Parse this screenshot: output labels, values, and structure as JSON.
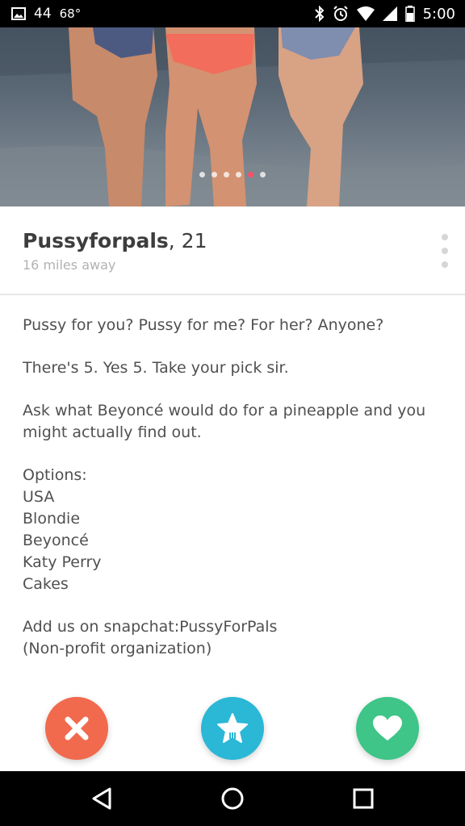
{
  "status_bar": {
    "notification_count": "44",
    "temperature": "68°",
    "time": "5:00",
    "icons": [
      "image-icon",
      "bluetooth-icon",
      "alarm-icon",
      "wifi-icon",
      "signal-icon",
      "battery-icon"
    ]
  },
  "photo": {
    "dot_count": 6,
    "active_dot_index": 4
  },
  "profile": {
    "name": "Pussyforpals",
    "age_text": ", 21",
    "distance": "16 miles away"
  },
  "bio": {
    "line_1": "Pussy for you? Pussy for me? For her? Anyone?",
    "line_2": "There's 5. Yes 5. Take your pick sir.",
    "line_3": "Ask what Beyoncé would do for a pineapple and you might actually find out.",
    "options_title": "Options:",
    "options": [
      "USA",
      "Blondie",
      "Beyoncé",
      "Katy Perry",
      "Cakes"
    ],
    "line_4": "Add us on snapchat:PussyForPals",
    "line_5": "(Non-profit organization)"
  },
  "actions": {
    "nope_icon": "close-icon",
    "super_like_icon": "star-icon",
    "like_icon": "heart-icon"
  },
  "colors": {
    "nope": "#f16a4d",
    "super_like": "#2bb7d6",
    "like": "#3ec587",
    "active_dot": "#fd5068"
  }
}
